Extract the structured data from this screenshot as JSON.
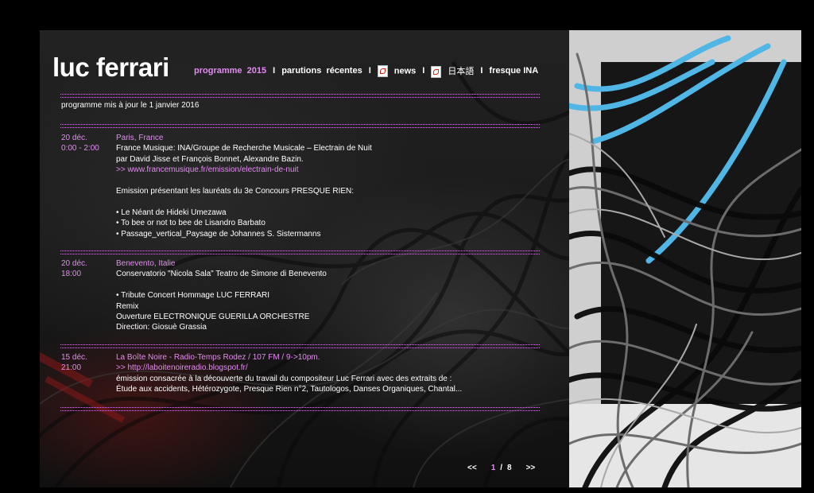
{
  "site": {
    "title": "luc ferrari"
  },
  "nav": {
    "programme": "programme",
    "year": "2015",
    "parutions": "parutions",
    "recentes": "récentes",
    "news": "news",
    "japanese": "日本語",
    "fresque": "fresque INA",
    "separator": "I",
    "icons": [
      "pdf-icon",
      "pdf-icon"
    ]
  },
  "updated": "programme mis à jour le 1 janvier 2016",
  "events": [
    {
      "day": "20 déc.",
      "time": "0:00 - 2:00",
      "place": "Paris, France",
      "lines": [
        "France Musique: INA/Groupe de Recherche Musicale – Electrain de Nuit",
        "par David Jisse et François Bonnet, Alexandre Bazin.",
        ">> www.francemusique.fr/emission/electrain-de-nuit",
        "",
        "Emission présentant les lauréats du 3e Concours PRESQUE RIEN:",
        "",
        "• Le Néant de Hideki Umezawa",
        "• To bee or not to bee de Lisandro Barbato",
        "• Passage_vertical_Paysage de Johannes S. Sistermanns"
      ]
    },
    {
      "day": "20 déc.",
      "time": "18:00",
      "place": "Benevento, Italie",
      "lines": [
        "Conservatorio \"Nicola Sala\" Teatro de Simone di Benevento",
        "",
        "•  Tribute Concert Hommage LUC FERRARI",
        "Remix",
        "Ouverture ELECTRONIQUE GUERILLA ORCHESTRE",
        "Direction: Giosuè Grassia"
      ]
    },
    {
      "day": "15 déc.",
      "time": "21:00",
      "place": "La Boîte Noire - Radio-Temps Rodez / 107 FM / 9->10pm.",
      "lines": [
        ">> http://laboitenoireradio.blogspot.fr/",
        "émission consacrée à la découverte du travail du compositeur Luc Ferrari avec des extraits de :",
        "Étude aux accidents, Hétérozygote, Presque Rien n°2, Tautologos, Danses Organiques, Chantal..."
      ]
    }
  ],
  "pager": {
    "prev": "<<",
    "current": "1",
    "sep": "/",
    "total": "8",
    "next": ">>"
  },
  "colors": {
    "accent": "#e28cf0",
    "background": "#000000",
    "text": "#ffffff",
    "cable_blue": "#3ab0e0"
  }
}
